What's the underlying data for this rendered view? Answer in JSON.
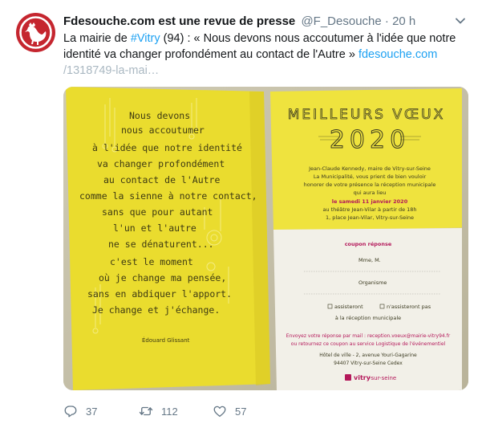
{
  "tweet": {
    "display_name": "Fdesouche.com est une revue de presse",
    "handle": "@F_Desouche",
    "separator": "·",
    "time": "20 h",
    "text_before_hashtag": "La mairie de ",
    "hashtag": "#Vitry",
    "text_after_hashtag": " (94) : « Nous devons nous accoutumer à l'idée que notre identité va changer profondément au contact de l'Autre » ",
    "link_domain": "fdesouche.com",
    "link_path": "/1318749-la-mai…",
    "reply_count": "37",
    "retweet_count": "112",
    "like_count": "57"
  },
  "card_left": {
    "poem_lines": [
      "Nous devons",
      "nous accoutumer",
      "à l'idée que notre identité",
      "va changer profondément",
      "au contact de l'Autre",
      "comme la sienne à notre contact,",
      "sans que pour autant",
      "l'un et l'autre",
      "ne se dénaturent...",
      "c'est le moment",
      "où je change ma pensée,",
      "sans en abdiquer l'apport.",
      "Je change et j'échange."
    ],
    "author": "Édouard Glissant"
  },
  "card_right": {
    "greeting": "MEILLEURS VŒUX",
    "year": "2020",
    "invitation_lines": [
      "Jean-Claude Kennedy, maire de Vitry-sur-Seine",
      "La Municipalité, vous prient de bien vouloir",
      "honorer de votre présence la réception municipale",
      "qui aura lieu",
      "le samedi 11 janvier 2020",
      "au théâtre Jean-Vilar à partir de 18h",
      "1, place Jean-Vilar, Vitry-sur-Seine"
    ],
    "coupon_title": "coupon réponse",
    "coupon_name": "Mme, M.",
    "coupon_org": "Organisme",
    "opt_yes": "assisteront",
    "opt_no": "n'assisteront pas",
    "opt_suffix": "à la réception municipale",
    "return_lines": [
      "Envoyez votre réponse par mail : reception.voeux@mairie-vitry94.fr",
      "ou retournez ce coupon au service Logistique de l'événementiel",
      "Hôtel de ville - 2, avenue Youri-Gagarine",
      "94407 Vitry-sur-Seine Cedex"
    ],
    "logo_text": "vitry",
    "logo_suffix": "-sur-seine"
  },
  "colors": {
    "link": "#1da1f2",
    "muted": "#657786",
    "avatar": "#c5262f",
    "card_yellow": "#efe23c",
    "card_yellow_dark": "#d9c92a"
  }
}
